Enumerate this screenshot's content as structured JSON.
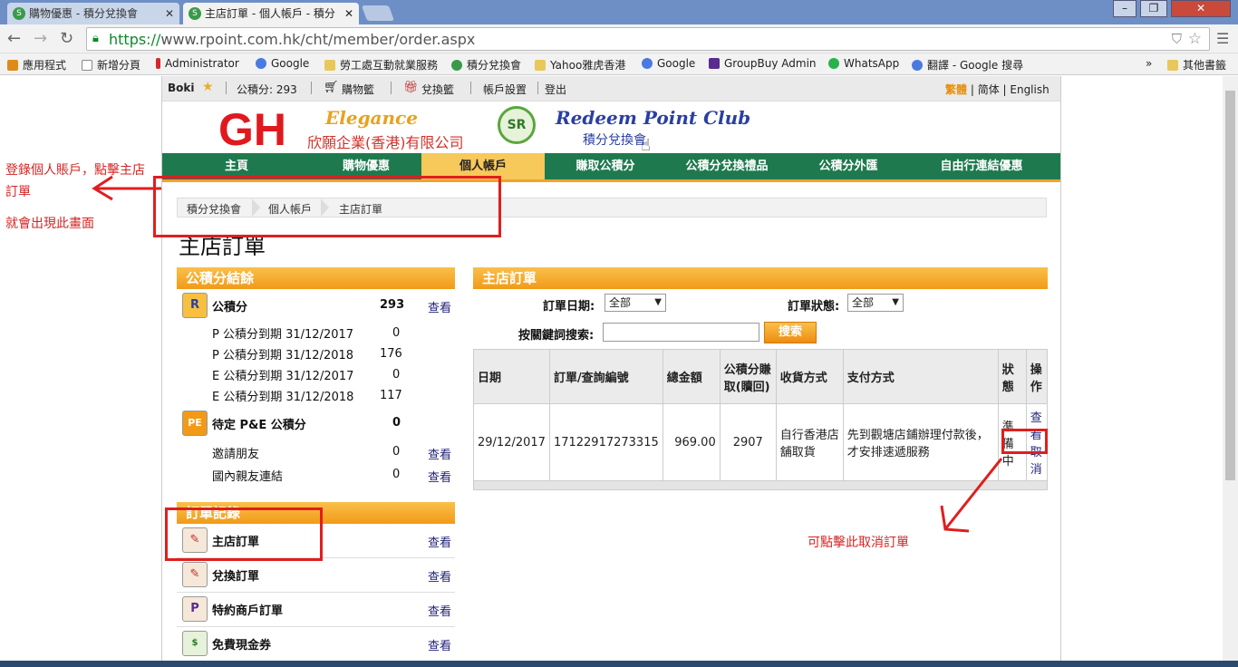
{
  "browser": {
    "tabs": [
      {
        "title": "購物優惠 - 積分兌換會",
        "active": false
      },
      {
        "title": "主店訂單 - 個人帳戶 - 積分",
        "active": true
      }
    ],
    "url_secure": "https://",
    "url_rest": "www.rpoint.com.hk/cht/member/order.aspx",
    "bookmarks": [
      "應用程式",
      "新增分頁",
      "Administrator",
      "Google",
      "勞工處互動就業服務",
      "積分兌換會",
      "Yahoo雅虎香港",
      "Google",
      "GroupBuy Admin",
      "WhatsApp",
      "翻譯 - Google 搜尋",
      "其他書籤"
    ],
    "overflow": "»"
  },
  "topbar": {
    "user": "Boki",
    "points": "公積分: 293",
    "cart": "購物籃",
    "redeem_cart": "兌換籃",
    "settings": "帳戶設置",
    "logout": "登出",
    "lang_current": "繁體",
    "lang_simplified": "简体",
    "lang_english": "English"
  },
  "header": {
    "gh": "GH",
    "elegance": "Elegance",
    "company": "欣願企業(香港)有限公司",
    "sr": "SR",
    "club": "Redeem Point Club",
    "club_sub": "積分兌換會"
  },
  "nav": [
    "主頁",
    "購物優惠",
    "個人帳戶",
    "賺取公積分",
    "公積分兌換禮品",
    "公積分外匯",
    "自由行連結優惠"
  ],
  "breadcrumb": [
    "積分兌換會",
    "個人帳戶",
    "主店訂單"
  ],
  "page_title": "主店訂單",
  "balance": {
    "title": "公積分結餘",
    "points_label": "公積分",
    "points_value": "293",
    "view": "查看",
    "expiry": [
      {
        "label": "P 公積分到期 31/12/2017",
        "value": "0"
      },
      {
        "label": "P 公積分到期 31/12/2018",
        "value": "176"
      },
      {
        "label": "E 公積分到期 31/12/2017",
        "value": "0"
      },
      {
        "label": "E 公積分到期 31/12/2018",
        "value": "117"
      }
    ],
    "pending_label": "待定 P&E 公積分",
    "pending_value": "0",
    "invite_label": "邀請朋友",
    "invite_value": "0",
    "domestic_label": "國內親友連結",
    "domestic_value": "0"
  },
  "records": {
    "title": "訂單記錄",
    "items": [
      "主店訂單",
      "兌換訂單",
      "特約商戶訂單",
      "免費現金券"
    ],
    "view": "查看"
  },
  "orders": {
    "title": "主店訂單",
    "date_label": "訂單日期:",
    "date_value": "全部",
    "status_label": "訂單狀態:",
    "status_value": "全部",
    "search_label": "按關鍵詞搜索:",
    "search_button": "搜索",
    "columns": [
      "日期",
      "訂單/查詢編號",
      "總金額",
      "公積分賺取(贖回)",
      "收貨方式",
      "支付方式",
      "狀態",
      "操作"
    ],
    "row": {
      "date": "29/12/2017",
      "order_no": "17122917273315",
      "amount": "969.00",
      "points": "2907",
      "delivery": "自行香港店舖取貨",
      "payment": "先到觀塘店鋪辦理付款後，才安排速遞服務",
      "status": "準備中",
      "view": "查看",
      "cancel": "取消"
    }
  },
  "annotations": {
    "left_note_1": "登錄個人賬戶，點擊主店訂單",
    "left_note_2": "就會出現此畫面",
    "cancel_note": "可點擊此取消訂單",
    "color": "#e01e1e"
  },
  "colors": {
    "green_nav": "#1e7a4e",
    "orange": "#f29a18",
    "red_logo": "#e0191e"
  }
}
